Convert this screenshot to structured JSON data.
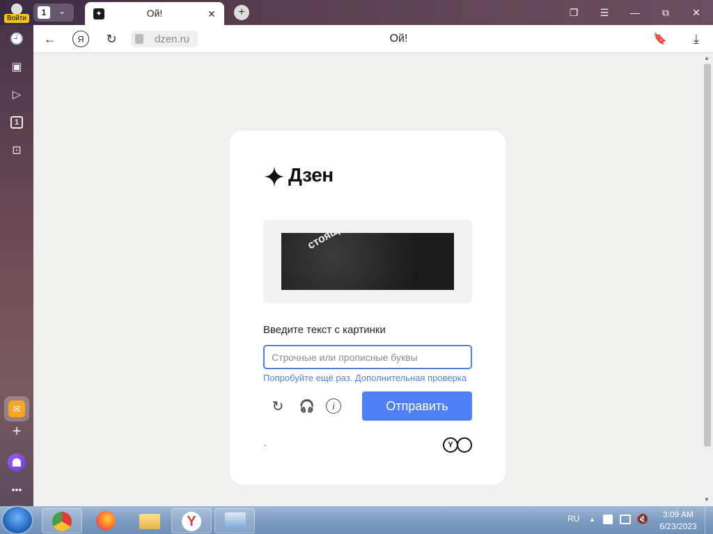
{
  "browser": {
    "login_label": "Войти",
    "tab_count": "1",
    "tab_title": "Ой!",
    "url": "dzen.ru",
    "page_title": "Ой!"
  },
  "page": {
    "logo_text": "Дзен",
    "captcha_words": "стоящее надежд",
    "prompt": "Введите текст с картинки",
    "input_placeholder": "Строчные или прописные буквы",
    "retry_link": "Попробуйте ещё раз. Дополнительная проверка",
    "submit_label": "Отправить",
    "footer_dot": "."
  },
  "taskbar": {
    "lang": "RU",
    "time": "3:09 AM",
    "date": "6/23/2023"
  },
  "colors": {
    "accent": "#4f80f7",
    "input_border": "#4a7ee0",
    "link": "#4a7ee0"
  }
}
